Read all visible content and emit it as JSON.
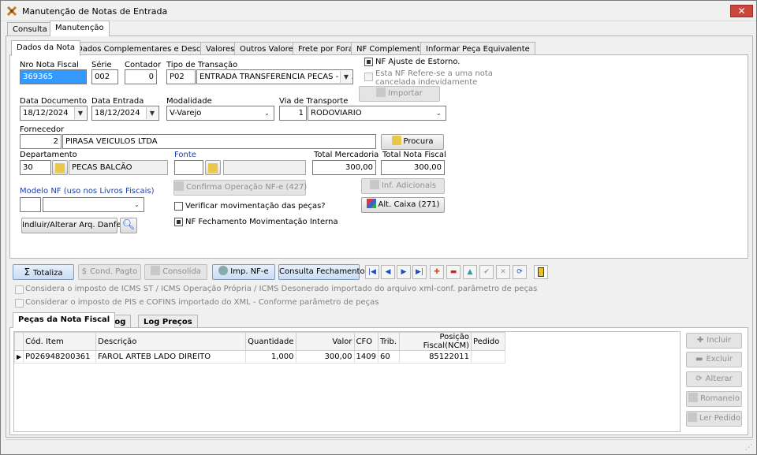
{
  "window": {
    "title": "Manutenção de Notas de Entrada",
    "close": "✕"
  },
  "outer_tabs": [
    "Consulta",
    "Manutenção"
  ],
  "inner_tabs": [
    "Dados da Nota",
    "Dados Complementares e Desconto",
    "Valores",
    "Outros Valores",
    "Frete por Fora",
    "NF Complementar",
    "Informar Peça Equivalente"
  ],
  "form": {
    "nro_nota_label": "Nro Nota Fiscal",
    "nro_nota": "369365",
    "serie_label": "Série",
    "serie": "002",
    "contador_label": "Contador",
    "contador": "0",
    "tipo_transacao_label": "Tipo de Transação",
    "tipo_codigo": "P02",
    "tipo_desc": "ENTRADA TRANSFERENCIA PECAS - FILI",
    "nf_ajuste_label": "NF Ajuste  de Estorno.",
    "nf_refere_label": "Esta NF Refere-se a uma nota cancelada indevidamente",
    "importar_label": "Importar",
    "data_doc_label": "Data Documento",
    "data_doc": "18/12/2024",
    "data_entrada_label": "Data Entrada",
    "data_entrada": "18/12/2024",
    "modalidade_label": "Modalidade",
    "modalidade": "V-Varejo",
    "via_label": "Via de Transporte",
    "via_codigo": "1",
    "via_desc": "RODOVIARIO",
    "fornecedor_label": "Fornecedor",
    "fornecedor_codigo": "2",
    "fornecedor_nome": "PIRASA VEICULOS LTDA",
    "procura_label": "Procura",
    "departamento_label": "Departamento",
    "departamento_codigo": "30",
    "departamento_nome": "PECAS BALCÃO",
    "fonte_label": "Fonte",
    "total_merc_label": "Total Mercadoria",
    "total_merc": "300,00",
    "total_nf_label": "Total Nota Fiscal",
    "total_nf": "300,00",
    "modelo_label": "Modelo NF (uso nos Livros Fiscais)",
    "confirma_label": "Confirma Operação NF-e (427)",
    "inf_adicionais_label": "Inf. Adicionais",
    "alt_caixa_label": "Alt. Caixa (271)",
    "verificar_label": "Verificar movimentação das peças?",
    "nf_fechamento_label": "NF Fechamento Movimentação Interna",
    "danfe_label": "Indluir/Alterar Arq. Danfe"
  },
  "toolbar": {
    "totaliza": "Totaliza",
    "cond_pagto": "Cond. Pagto",
    "consolida": "Consolida",
    "imp_nfe": "Imp. NF-e",
    "consulta_fechamento": "Consulta Fechamento"
  },
  "options": {
    "icms": "Considera o imposto de ICMS ST / ICMS Operação Própria / ICMS Desonerado importado do arquivo xml-conf. parâmetro de peças",
    "pis": "Considerar o imposto de PIS e COFINS importado do XML - Conforme parâmetro de peças"
  },
  "bottom_tabs": [
    "Peças da Nota Fiscal",
    "Log",
    "Log Preços"
  ],
  "grid": {
    "columns": [
      "Cód. Item",
      "Descrição",
      "Quantidade",
      "Valor",
      "CFO",
      "Trib.",
      "Posição Fiscal(NCM)",
      "Pedido"
    ],
    "rows": [
      [
        "P026948200361",
        "FAROL ARTEB LADO DIREITO",
        "1,000",
        "300,00",
        "1409",
        "60",
        "85122011",
        ""
      ]
    ]
  },
  "side_buttons": [
    "Incluir",
    "Excluir",
    "Alterar",
    "Romaneio",
    "Ler Pedido"
  ],
  "colors": {
    "accent": "#3399ff",
    "label_blue": "#1c3fa8",
    "close_red": "#c9463d"
  }
}
